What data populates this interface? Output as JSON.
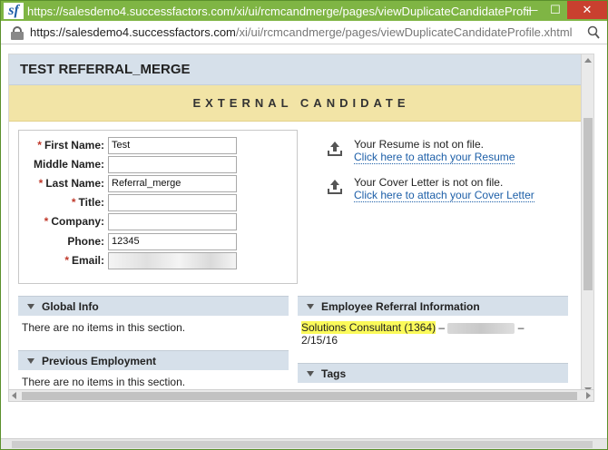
{
  "window": {
    "title": "https://salesdemo4.successfactors.com/xi/ui/rcmcandmerge/pages/viewDuplicateCandidateProfile...",
    "logo": "sf",
    "minimize": "—",
    "maximize": "☐",
    "close": "✕"
  },
  "address": {
    "url_main": "https://salesdemo4.successfactors.com",
    "url_rest": "/xi/ui/rcmcandmerge/pages/viewDuplicateCandidateProfile.xhtml"
  },
  "page": {
    "heading": "TEST REFERRAL_MERGE",
    "banner": "EXTERNAL CANDIDATE"
  },
  "form": {
    "fields": [
      {
        "label": "First Name:",
        "required": true,
        "value": "Test"
      },
      {
        "label": "Middle Name:",
        "required": false,
        "value": ""
      },
      {
        "label": "Last Name:",
        "required": true,
        "value": "Referral_merge"
      },
      {
        "label": "Title:",
        "required": true,
        "value": ""
      },
      {
        "label": "Company:",
        "required": true,
        "value": ""
      },
      {
        "label": "Phone:",
        "required": false,
        "value": "12345"
      },
      {
        "label": "Email:",
        "required": true,
        "value": ""
      }
    ],
    "required_mark": "*"
  },
  "attachments": {
    "resume_status": "Your Resume is not on file.",
    "resume_link": "Click here to attach your Resume",
    "cover_status": "Your Cover Letter is not on file.",
    "cover_link": "Click here to attach your Cover Letter"
  },
  "sections": {
    "global_info": {
      "title": "Global Info",
      "body": "There are no items in this section."
    },
    "previous_employment": {
      "title": "Previous Employment",
      "body": "There are no items in this section."
    },
    "referral": {
      "title": "Employee Referral Information",
      "job": "Solutions Consultant (1364)",
      "sep1": " – ",
      "sep2": " –",
      "date": "2/15/16"
    },
    "tags": {
      "title": "Tags"
    }
  }
}
